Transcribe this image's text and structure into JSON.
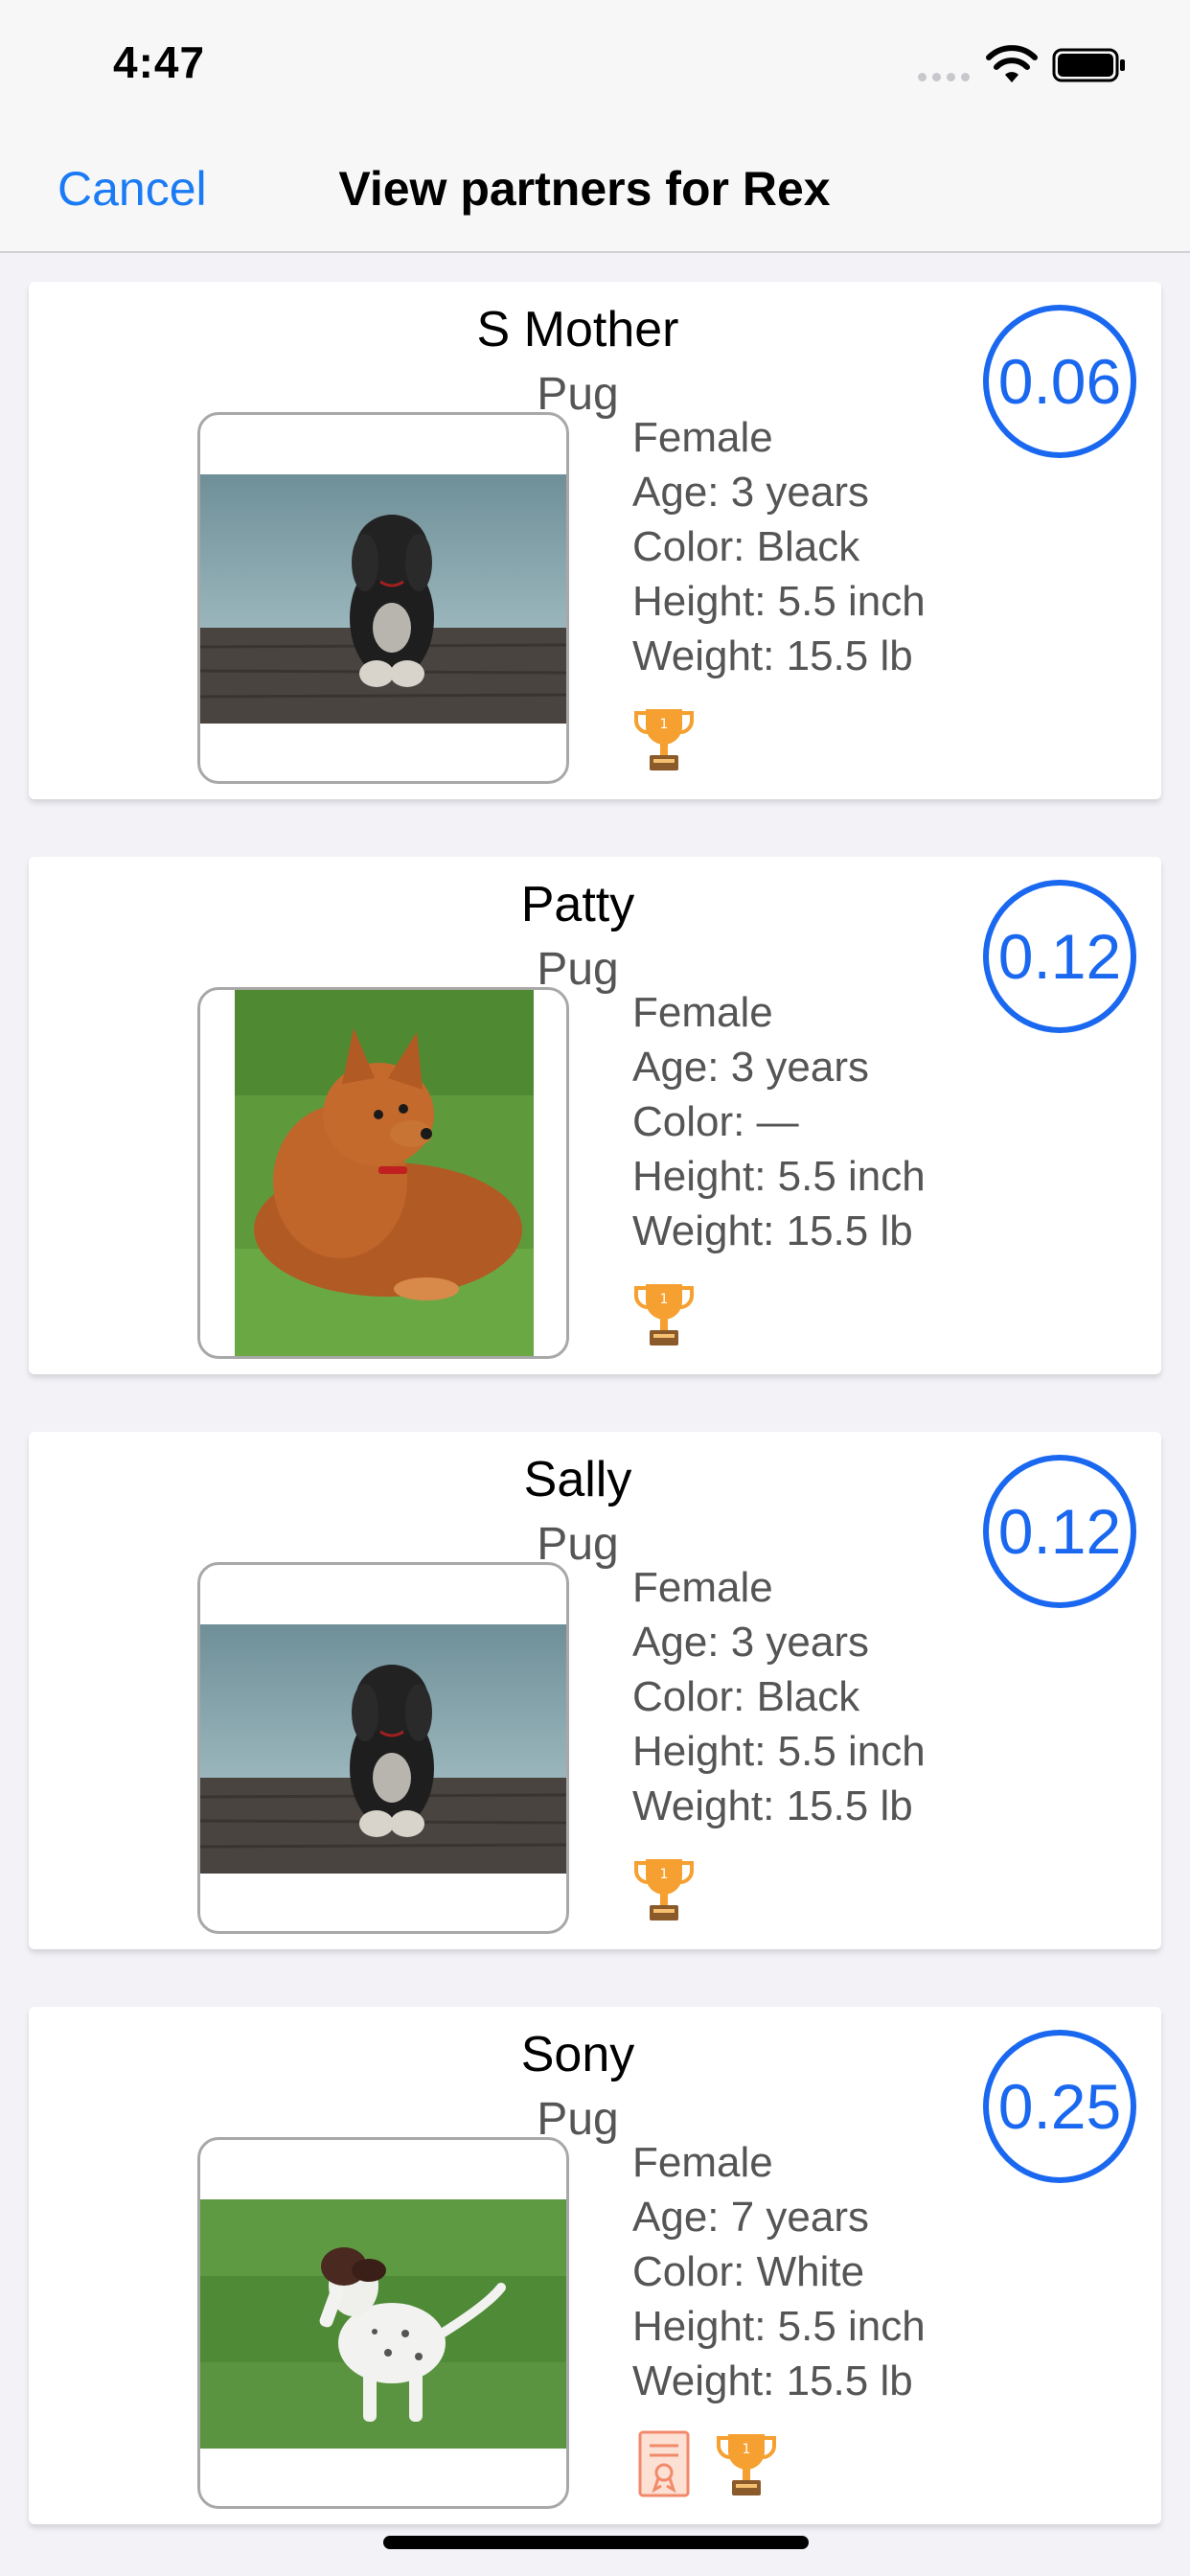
{
  "status_bar": {
    "time": "4:47"
  },
  "nav": {
    "cancel_label": "Cancel",
    "title": "View partners for Rex"
  },
  "colors": {
    "accent": "#1a7bf5",
    "score": "#1a68f0",
    "trophy": "#f5a030",
    "certificate": "#f08a6a"
  },
  "partners": [
    {
      "name": "S Mother",
      "breed": "Pug",
      "score": "0.06",
      "details": [
        "Female",
        "Age: 3 years",
        "Color: Black",
        "Height: 5.5 inch",
        "Weight: 15.5 lb"
      ],
      "awards": [
        "trophy-icon"
      ]
    },
    {
      "name": "Patty",
      "breed": "Pug",
      "score": "0.12",
      "details": [
        "Female",
        "Age: 3 years",
        "Color: —",
        "Height: 5.5 inch",
        "Weight: 15.5 lb"
      ],
      "awards": [
        "trophy-icon"
      ]
    },
    {
      "name": "Sally",
      "breed": "Pug",
      "score": "0.12",
      "details": [
        "Female",
        "Age: 3 years",
        "Color: Black",
        "Height: 5.5 inch",
        "Weight: 15.5 lb"
      ],
      "awards": [
        "trophy-icon"
      ]
    },
    {
      "name": "Sony",
      "breed": "Pug",
      "score": "0.25",
      "details": [
        "Female",
        "Age: 7 years",
        "Color: White",
        "Height: 5.5 inch",
        "Weight: 15.5 lb"
      ],
      "awards": [
        "certificate-icon",
        "trophy-icon"
      ]
    }
  ]
}
